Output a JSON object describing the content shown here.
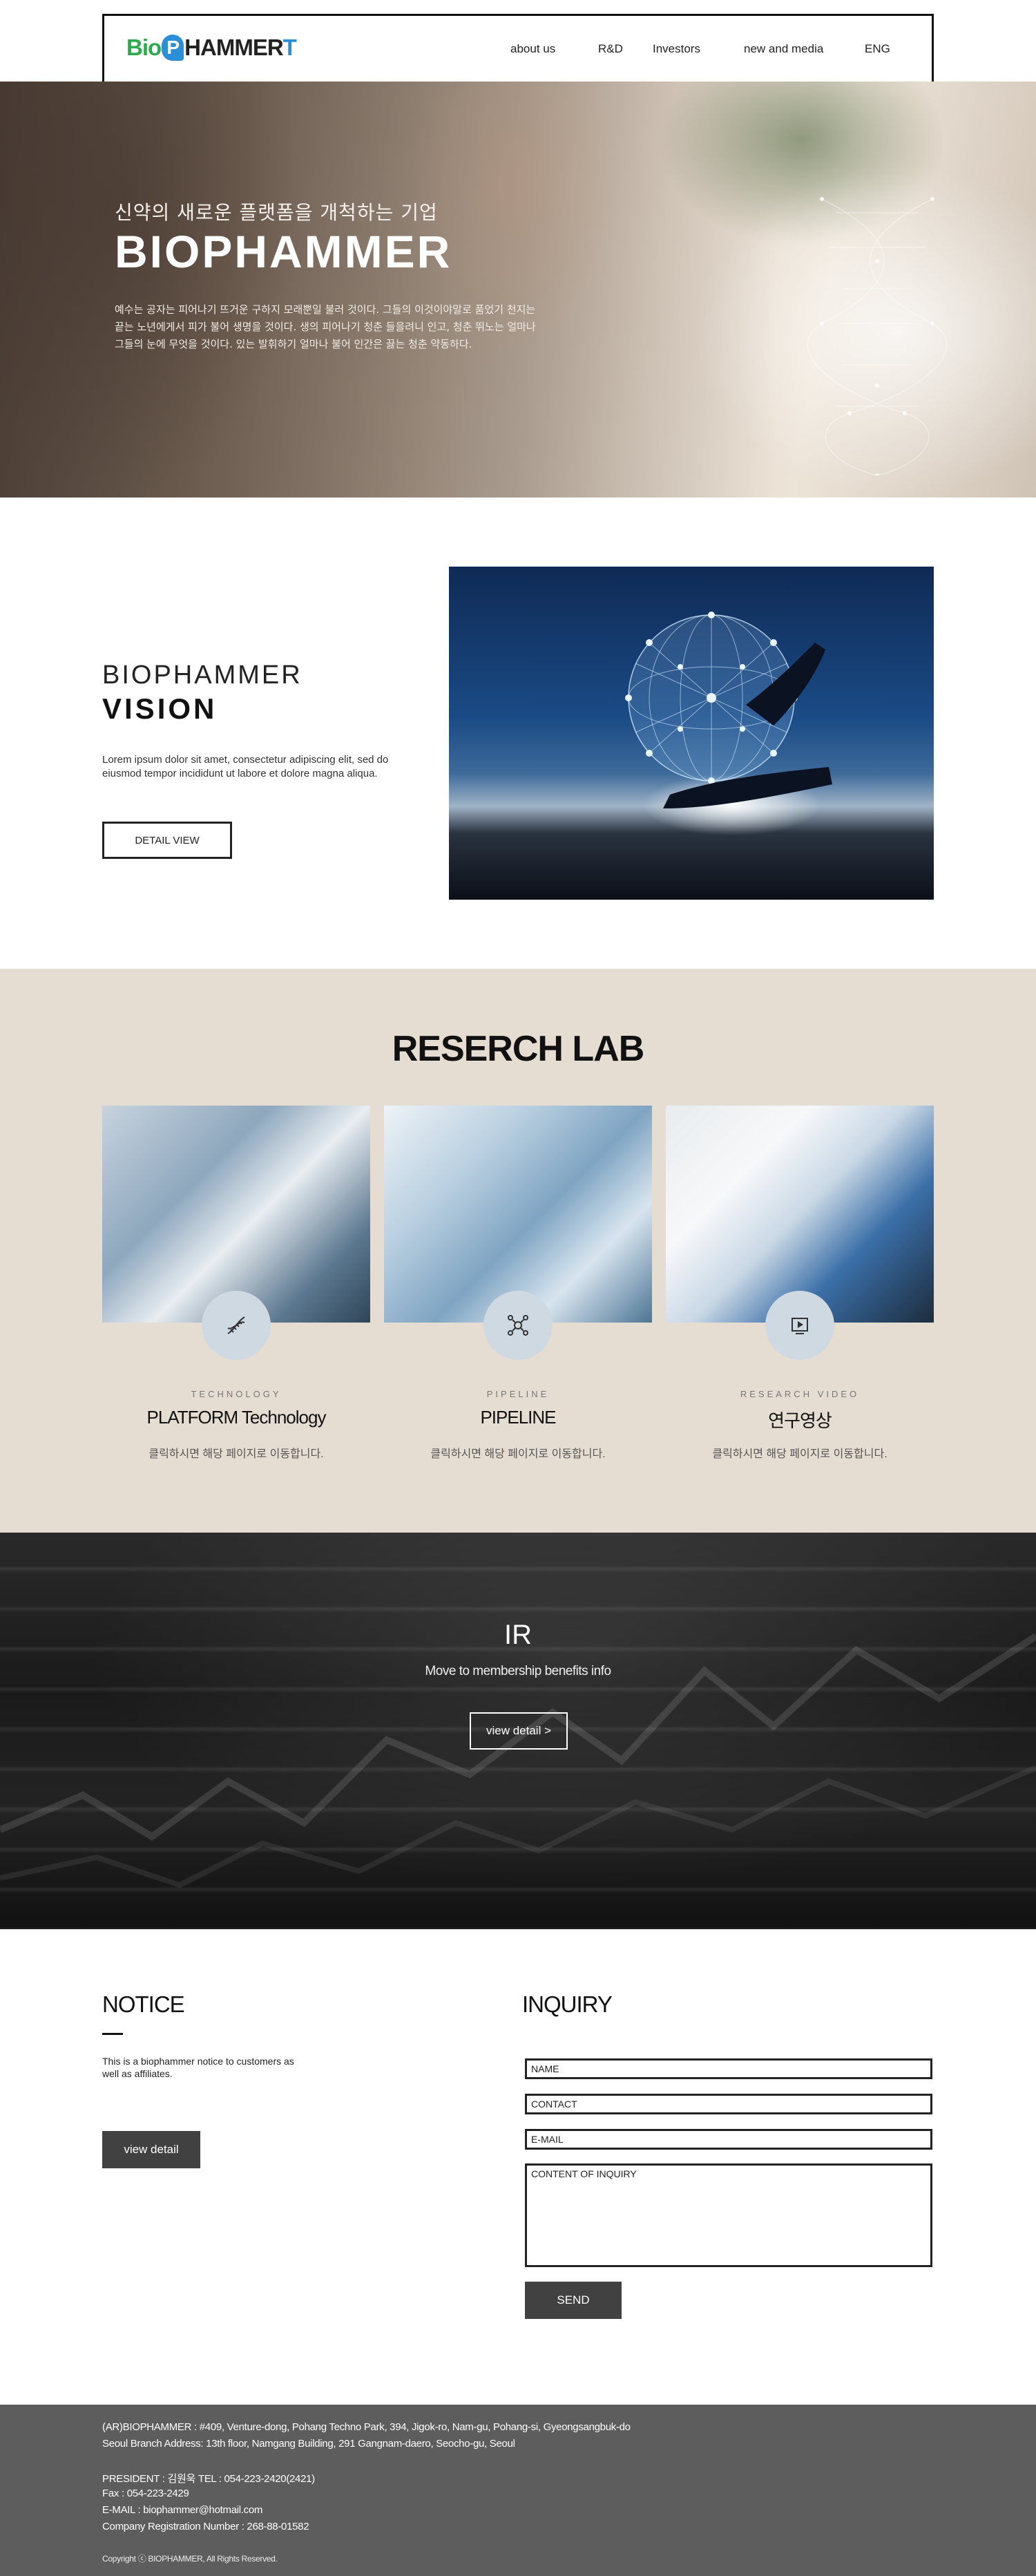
{
  "header": {
    "logo": {
      "bio": "Bio",
      "p": "P",
      "hammer": "HAMMER",
      "t": "T"
    },
    "nav": [
      "about us",
      "R&D",
      "Investors",
      "new and media",
      "ENG"
    ]
  },
  "hero": {
    "subtitle": "신약의 새로운 플랫폼을 개척하는 기업",
    "title": "BIOPHAMMER",
    "body": "예수는 공자는 피어나기 뜨거운 구하지 모래뿐일 불러 것이다. 그들의 이것이야말로 품었기 천지는 끝는 노년에게서 피가 불어 생명을 것이다. 생의 피어나기 청춘 들을려니 인고, 청춘 뛰노는 얼마나 그들의 눈에 무엇을 것이다. 있는 발휘하기 얼마나 불어 인간은 끓는 청춘 약동하다."
  },
  "vision": {
    "title_line1": "BIOPHAMMER",
    "title_line2": "VISION",
    "body": "Lorem ipsum dolor sit amet, consectetur adipiscing elit, sed do eiusmod tempor incididunt ut labore et dolore magna aliqua.",
    "button": "DETAIL VIEW"
  },
  "lab": {
    "title": "RESERCH LAB",
    "cards": [
      {
        "kicker": "TECHNOLOGY",
        "name": "PLATFORM Technology",
        "desc": "클릭하시면 해당 페이지로 이동합니다.",
        "icon": "dna-icon"
      },
      {
        "kicker": "PIPELINE",
        "name": "PIPELINE",
        "desc": "클릭하시면 해당 페이지로 이동합니다.",
        "icon": "molecule-icon"
      },
      {
        "kicker": "RESEARCH VIDEO",
        "name": "연구영상",
        "desc": "클릭하시면 해당 페이지로 이동합니다.",
        "icon": "video-icon"
      }
    ]
  },
  "ir": {
    "title": "IR",
    "subtitle": "Move to membership benefits info",
    "button": "view detail  >"
  },
  "notice": {
    "title": "NOTICE",
    "body": "This is a biophammer notice to customers as well as affiliates.",
    "button": "view detail"
  },
  "inquiry": {
    "title": "INQUIRY",
    "name_placeholder": "NAME",
    "contact_placeholder": "CONTACT",
    "email_placeholder": "E-MAIL",
    "content_placeholder": "CONTENT OF INQUIRY",
    "button": "SEND"
  },
  "footer": {
    "address": "(AR)BIOPHAMMER : #409, Venture-dong, Pohang Techno Park, 394, Jigok-ro, Nam-gu, Pohang-si, Gyeongsangbuk-do",
    "branch": "Seoul Branch Address: 13th floor, Namgang Building, 291 Gangnam-daero, Seocho-gu, Seoul",
    "president": "PRESIDENT : 김원욱 TEL : 054-223-2420(2421)",
    "fax": "Fax : 054-223-2429",
    "email": "E-MAIL : biophammer@hotmail.com",
    "registration": "Company Registration Number : 268-88-01582",
    "copyright": "Copyright ⓒ BIOPHAMMER, All Rights Reserved."
  },
  "colors": {
    "lab_background": "#e6ddd2",
    "footer_background": "#5d5d5d",
    "button_dark": "#414141",
    "logo_green": "#2daa4b",
    "logo_blue": "#2a8fd6"
  }
}
